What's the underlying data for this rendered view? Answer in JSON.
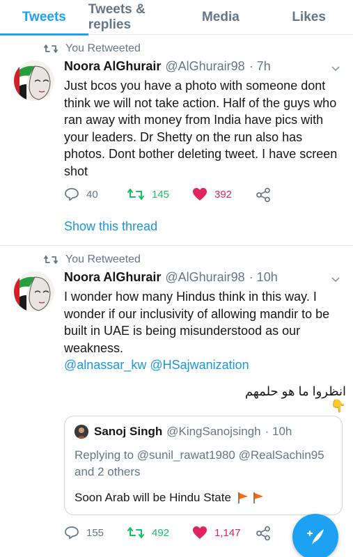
{
  "tabs": [
    {
      "label": "Tweets",
      "active": true
    },
    {
      "label": "Tweets & replies",
      "active": false
    },
    {
      "label": "Media",
      "active": false
    },
    {
      "label": "Likes",
      "active": false
    }
  ],
  "colors": {
    "accent": "#1da1f2",
    "retweet": "#17bf63",
    "like": "#e0245e",
    "muted": "#657786"
  },
  "tweets": [
    {
      "retweet_label": "You Retweeted",
      "name": "Noora AlGhurair",
      "handle": "@AlGhurair98",
      "time": "· 7h",
      "text": "Just bcos you have a photo with someone dont think we will not take action. Half of the guys who ran away with money from India have pics with your leaders. Dr Shetty on the run also has photos. Dont bother deleting tweet. I have screen shot",
      "replies": "40",
      "retweets": "145",
      "likes": "392",
      "thread_link": "Show this thread",
      "liked": true
    },
    {
      "retweet_label": "You Retweeted",
      "name": "Noora AlGhurair",
      "handle": "@AlGhurair98",
      "time": "· 10h",
      "text": "I wonder how many Hindus think in this way. I wonder if our inclusivity of allowing mandir to be built in UAE is being misunderstood as our weakness.",
      "mentions": "@alnassar_kw @HSajwanization",
      "arabic": "انظروا ما هو حلمهم 👇",
      "quote": {
        "name": "Sanoj Singh",
        "handle": "@KingSanojsingh",
        "time": "· 10h",
        "replying_prefix": "Replying to",
        "replying_to": "@sunil_rawat1980 @RealSachin95",
        "replying_suffix": "and 2 others",
        "text": "Soon Arab will be Hindu State"
      },
      "replies": "155",
      "retweets": "492",
      "likes": "1,147",
      "liked": true
    }
  ],
  "icons": [
    "retweet-icon",
    "reply-icon",
    "heart-icon",
    "share-icon",
    "chevron-down-icon",
    "compose-icon",
    "flag-icon"
  ]
}
